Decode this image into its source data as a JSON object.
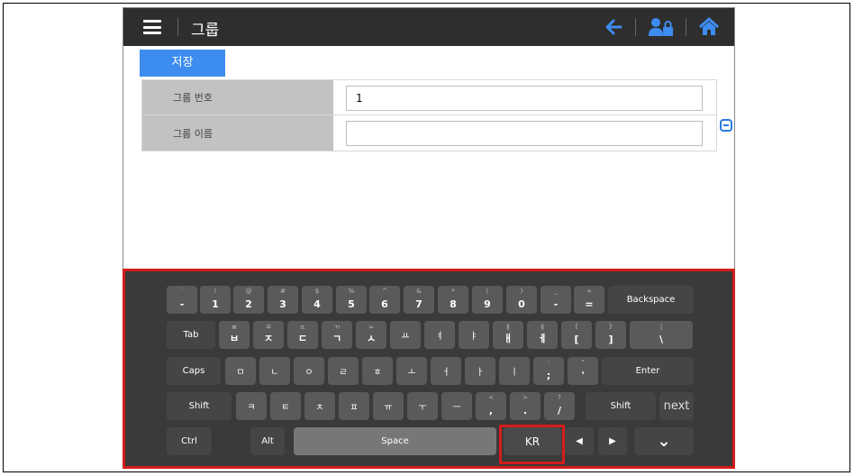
{
  "header": {
    "title": "그룹",
    "icons": [
      "menu-icon",
      "back-arrow-icon",
      "user-lock-icon",
      "home-icon"
    ],
    "icon_color": "#3d8cf0"
  },
  "toolbar": {
    "save_label": "저장"
  },
  "form": {
    "rows": [
      {
        "label": "그룹 번호",
        "value": "1"
      },
      {
        "label": "그룹 이름",
        "value": ""
      }
    ]
  },
  "keyboard": {
    "rows": [
      [
        {
          "m": "-",
          "s": "`"
        },
        {
          "m": "1",
          "s": "!"
        },
        {
          "m": "2",
          "s": "@"
        },
        {
          "m": "3",
          "s": "#"
        },
        {
          "m": "4",
          "s": "$"
        },
        {
          "m": "5",
          "s": "%"
        },
        {
          "m": "6",
          "s": "^"
        },
        {
          "m": "7",
          "s": "&"
        },
        {
          "m": "8",
          "s": "*"
        },
        {
          "m": "9",
          "s": "("
        },
        {
          "m": "0",
          "s": ")"
        },
        {
          "m": "-",
          "s": "_"
        },
        {
          "m": "=",
          "s": "+"
        },
        {
          "m": "Backspace",
          "s": ""
        }
      ],
      [
        {
          "m": "Tab",
          "s": ""
        },
        {
          "m": "ㅂ",
          "s": "ㅃ"
        },
        {
          "m": "ㅈ",
          "s": "ㅉ"
        },
        {
          "m": "ㄷ",
          "s": "ㄸ"
        },
        {
          "m": "ㄱ",
          "s": "ㄲ"
        },
        {
          "m": "ㅅ",
          "s": "ㅆ"
        },
        {
          "m": "ㅛ",
          "s": ""
        },
        {
          "m": "ㅕ",
          "s": ""
        },
        {
          "m": "ㅑ",
          "s": ""
        },
        {
          "m": "ㅐ",
          "s": "ㅒ"
        },
        {
          "m": "ㅔ",
          "s": "ㅖ"
        },
        {
          "m": "[",
          "s": "{"
        },
        {
          "m": "]",
          "s": "}"
        },
        {
          "m": "\\",
          "s": "|"
        }
      ],
      [
        {
          "m": "Caps",
          "s": ""
        },
        {
          "m": "ㅁ",
          "s": ""
        },
        {
          "m": "ㄴ",
          "s": ""
        },
        {
          "m": "ㅇ",
          "s": ""
        },
        {
          "m": "ㄹ",
          "s": ""
        },
        {
          "m": "ㅎ",
          "s": ""
        },
        {
          "m": "ㅗ",
          "s": ""
        },
        {
          "m": "ㅓ",
          "s": ""
        },
        {
          "m": "ㅏ",
          "s": ""
        },
        {
          "m": "ㅣ",
          "s": ""
        },
        {
          "m": ";",
          "s": ":"
        },
        {
          "m": "'",
          "s": "\""
        },
        {
          "m": "Enter",
          "s": ""
        }
      ],
      [
        {
          "m": "Shift",
          "s": ""
        },
        {
          "m": "ㅋ",
          "s": ""
        },
        {
          "m": "ㅌ",
          "s": ""
        },
        {
          "m": "ㅊ",
          "s": ""
        },
        {
          "m": "ㅍ",
          "s": ""
        },
        {
          "m": "ㅠ",
          "s": ""
        },
        {
          "m": "ㅜ",
          "s": ""
        },
        {
          "m": "ㅡ",
          "s": ""
        },
        {
          "m": ",",
          "s": "<"
        },
        {
          "m": ".",
          "s": ">"
        },
        {
          "m": "/",
          "s": "?"
        },
        {
          "m": "Shift",
          "s": ""
        },
        {
          "m": "next",
          "s": ""
        }
      ],
      [
        {
          "m": "Ctrl",
          "s": ""
        },
        {
          "m": "Alt",
          "s": ""
        },
        {
          "m": "Space",
          "s": ""
        },
        {
          "m": "KR",
          "s": ""
        },
        {
          "m": "◀",
          "s": ""
        },
        {
          "m": "▶",
          "s": ""
        },
        {
          "m": "⌄",
          "s": ""
        }
      ]
    ]
  }
}
